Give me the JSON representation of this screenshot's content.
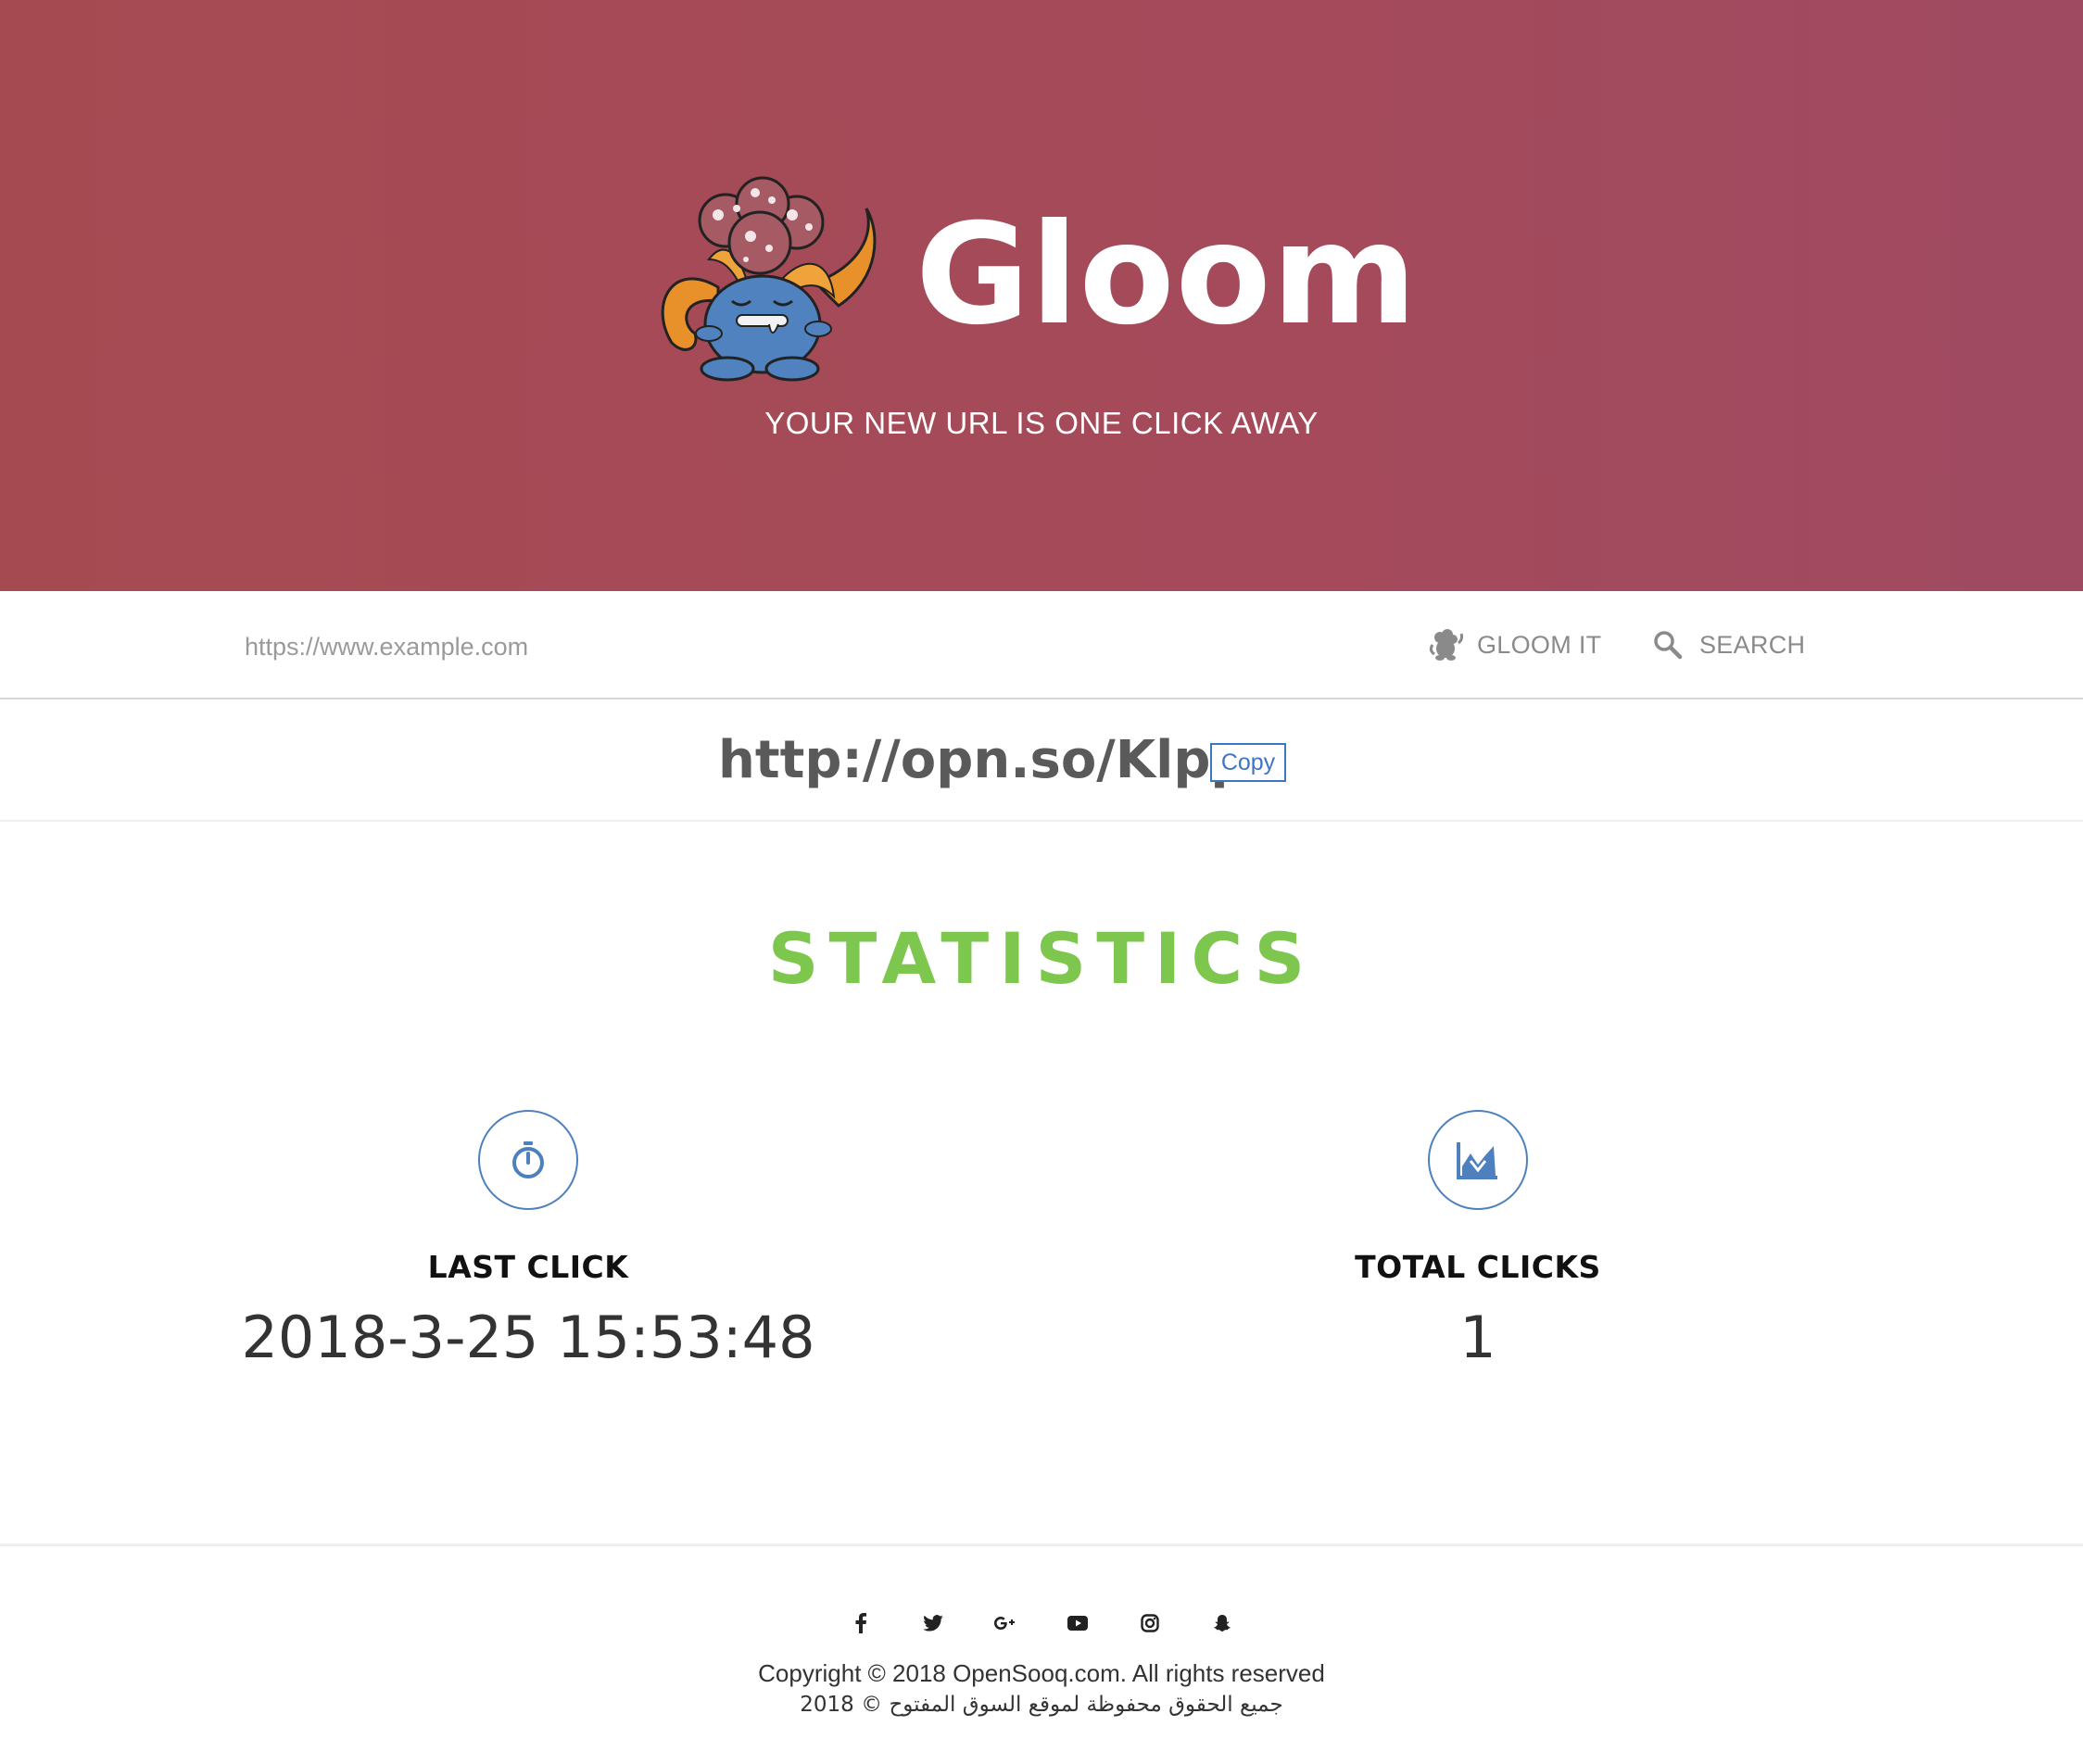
{
  "hero": {
    "brand_name": "Gloom",
    "tagline": "YOUR NEW URL IS ONE CLICK AWAY",
    "mascot_icon": "gloom-mascot-icon"
  },
  "toolbar": {
    "url_placeholder": "https://www.example.com",
    "gloom_label": "GLOOM IT",
    "search_label": "SEARCH"
  },
  "result": {
    "short_url": "http://opn.so/Klpp",
    "copy_label": "Copy"
  },
  "statistics": {
    "title": "STATISTICS",
    "last_click": {
      "label": "LAST CLICK",
      "value": "2018-3-25 15:53:48",
      "icon": "stopwatch-icon"
    },
    "total_clicks": {
      "label": "TOTAL CLICKS",
      "value": "1",
      "icon": "line-chart-icon"
    }
  },
  "footer": {
    "socials": [
      "facebook-icon",
      "twitter-icon",
      "google-plus-icon",
      "youtube-icon",
      "instagram-icon",
      "snapchat-icon"
    ],
    "copyright": "Copyright © 2018 OpenSooq.com. All rights reserved",
    "copyright_ar": "جميع الحقوق محفوظة لموقع السوق المفتوح © 2018"
  },
  "colors": {
    "hero_bg": "#a64a52",
    "accent_green": "#7ec74f",
    "accent_blue": "#3d76c3"
  }
}
